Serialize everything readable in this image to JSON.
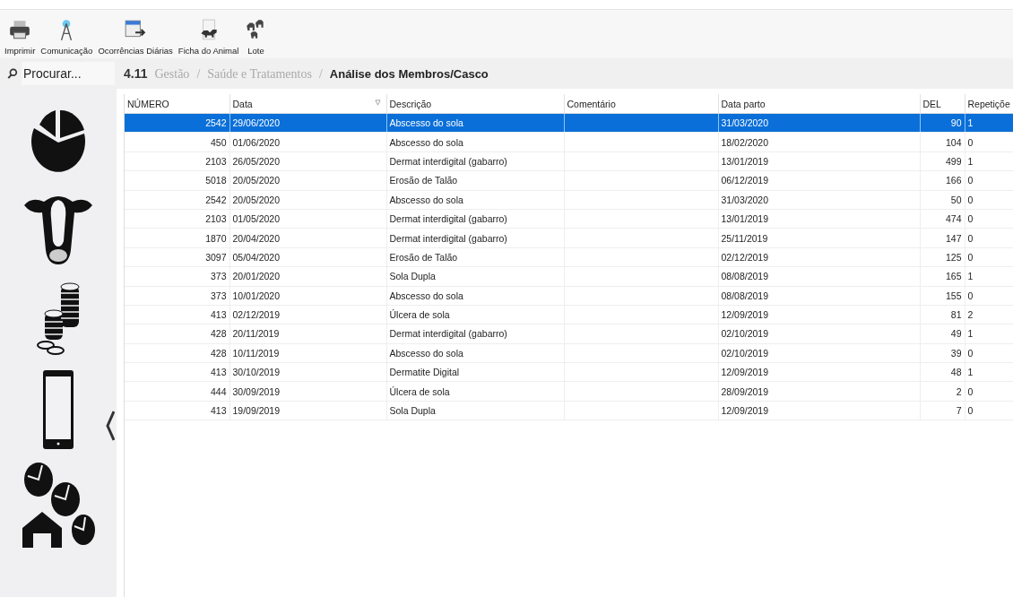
{
  "toolbar": [
    {
      "label": "Imprimir",
      "kind": "printer"
    },
    {
      "label": "Comunicação",
      "kind": "antenna"
    },
    {
      "label": "Ocorrências Diárias",
      "kind": "calendar"
    },
    {
      "label": "Ficha do Animal",
      "kind": "animal"
    },
    {
      "label": "Lote",
      "kind": "herd"
    }
  ],
  "search": {
    "placeholder": "Procurar..."
  },
  "breadcrumb": [
    {
      "text": "4.11",
      "kind": "code"
    },
    {
      "text": "Gestão",
      "kind": "link"
    },
    {
      "text": "/",
      "kind": "sep"
    },
    {
      "text": "Saúde e Tratamentos",
      "kind": "link"
    },
    {
      "text": "/",
      "kind": "sep"
    },
    {
      "text": "Análise dos Membros/Casco",
      "kind": "current"
    }
  ],
  "sidebar": {
    "items": [
      {
        "kind": "pie"
      },
      {
        "kind": "cow"
      },
      {
        "kind": "coins"
      },
      {
        "kind": "phone"
      },
      {
        "kind": "pies"
      }
    ]
  },
  "table": {
    "columns": [
      {
        "label": "NÚMERO",
        "sorted": false
      },
      {
        "label": "Data",
        "sorted": true
      },
      {
        "label": "Descrição",
        "sorted": false
      },
      {
        "label": "Comentário",
        "sorted": false
      },
      {
        "label": "Data parto",
        "sorted": false
      },
      {
        "label": "DEL",
        "sorted": false
      },
      {
        "label": "Repetiçõe",
        "sorted": false
      }
    ],
    "rows": [
      {
        "cells": [
          "2542",
          "29/06/2020",
          "Abscesso do sola",
          "",
          "31/03/2020",
          "90",
          "1"
        ],
        "selected": true
      },
      {
        "cells": [
          "450",
          "01/06/2020",
          "Abscesso do sola",
          "",
          "18/02/2020",
          "104",
          "0"
        ],
        "selected": false
      },
      {
        "cells": [
          "2103",
          "26/05/2020",
          "Dermat interdigital (gabarro)",
          "",
          "13/01/2019",
          "499",
          "1"
        ],
        "selected": false
      },
      {
        "cells": [
          "5018",
          "20/05/2020",
          "Erosão de Talão",
          "",
          "06/12/2019",
          "166",
          "0"
        ],
        "selected": false
      },
      {
        "cells": [
          "2542",
          "20/05/2020",
          "Abscesso do sola",
          "",
          "31/03/2020",
          "50",
          "0"
        ],
        "selected": false
      },
      {
        "cells": [
          "2103",
          "01/05/2020",
          "Dermat interdigital (gabarro)",
          "",
          "13/01/2019",
          "474",
          "0"
        ],
        "selected": false
      },
      {
        "cells": [
          "1870",
          "20/04/2020",
          "Dermat interdigital (gabarro)",
          "",
          "25/11/2019",
          "147",
          "0"
        ],
        "selected": false
      },
      {
        "cells": [
          "3097",
          "05/04/2020",
          "Erosão de Talão",
          "",
          "02/12/2019",
          "125",
          "0"
        ],
        "selected": false
      },
      {
        "cells": [
          "373",
          "20/01/2020",
          "Sola Dupla",
          "",
          "08/08/2019",
          "165",
          "1"
        ],
        "selected": false
      },
      {
        "cells": [
          "373",
          "10/01/2020",
          "Abscesso do sola",
          "",
          "08/08/2019",
          "155",
          "0"
        ],
        "selected": false
      },
      {
        "cells": [
          "413",
          "02/12/2019",
          "Úlcera de sola",
          "",
          "12/09/2019",
          "81",
          "2"
        ],
        "selected": false
      },
      {
        "cells": [
          "428",
          "20/11/2019",
          "Dermat interdigital (gabarro)",
          "",
          "02/10/2019",
          "49",
          "1"
        ],
        "selected": false
      },
      {
        "cells": [
          "428",
          "10/11/2019",
          "Abscesso do sola",
          "",
          "02/10/2019",
          "39",
          "0"
        ],
        "selected": false
      },
      {
        "cells": [
          "413",
          "30/10/2019",
          "Dermatite Digital",
          "",
          "12/09/2019",
          "48",
          "1"
        ],
        "selected": false
      },
      {
        "cells": [
          "444",
          "30/09/2019",
          "Úlcera de sola",
          "",
          "28/09/2019",
          "2",
          "0"
        ],
        "selected": false
      },
      {
        "cells": [
          "413",
          "19/09/2019",
          "Sola Dupla",
          "",
          "12/09/2019",
          "7",
          "0"
        ],
        "selected": false
      }
    ]
  }
}
